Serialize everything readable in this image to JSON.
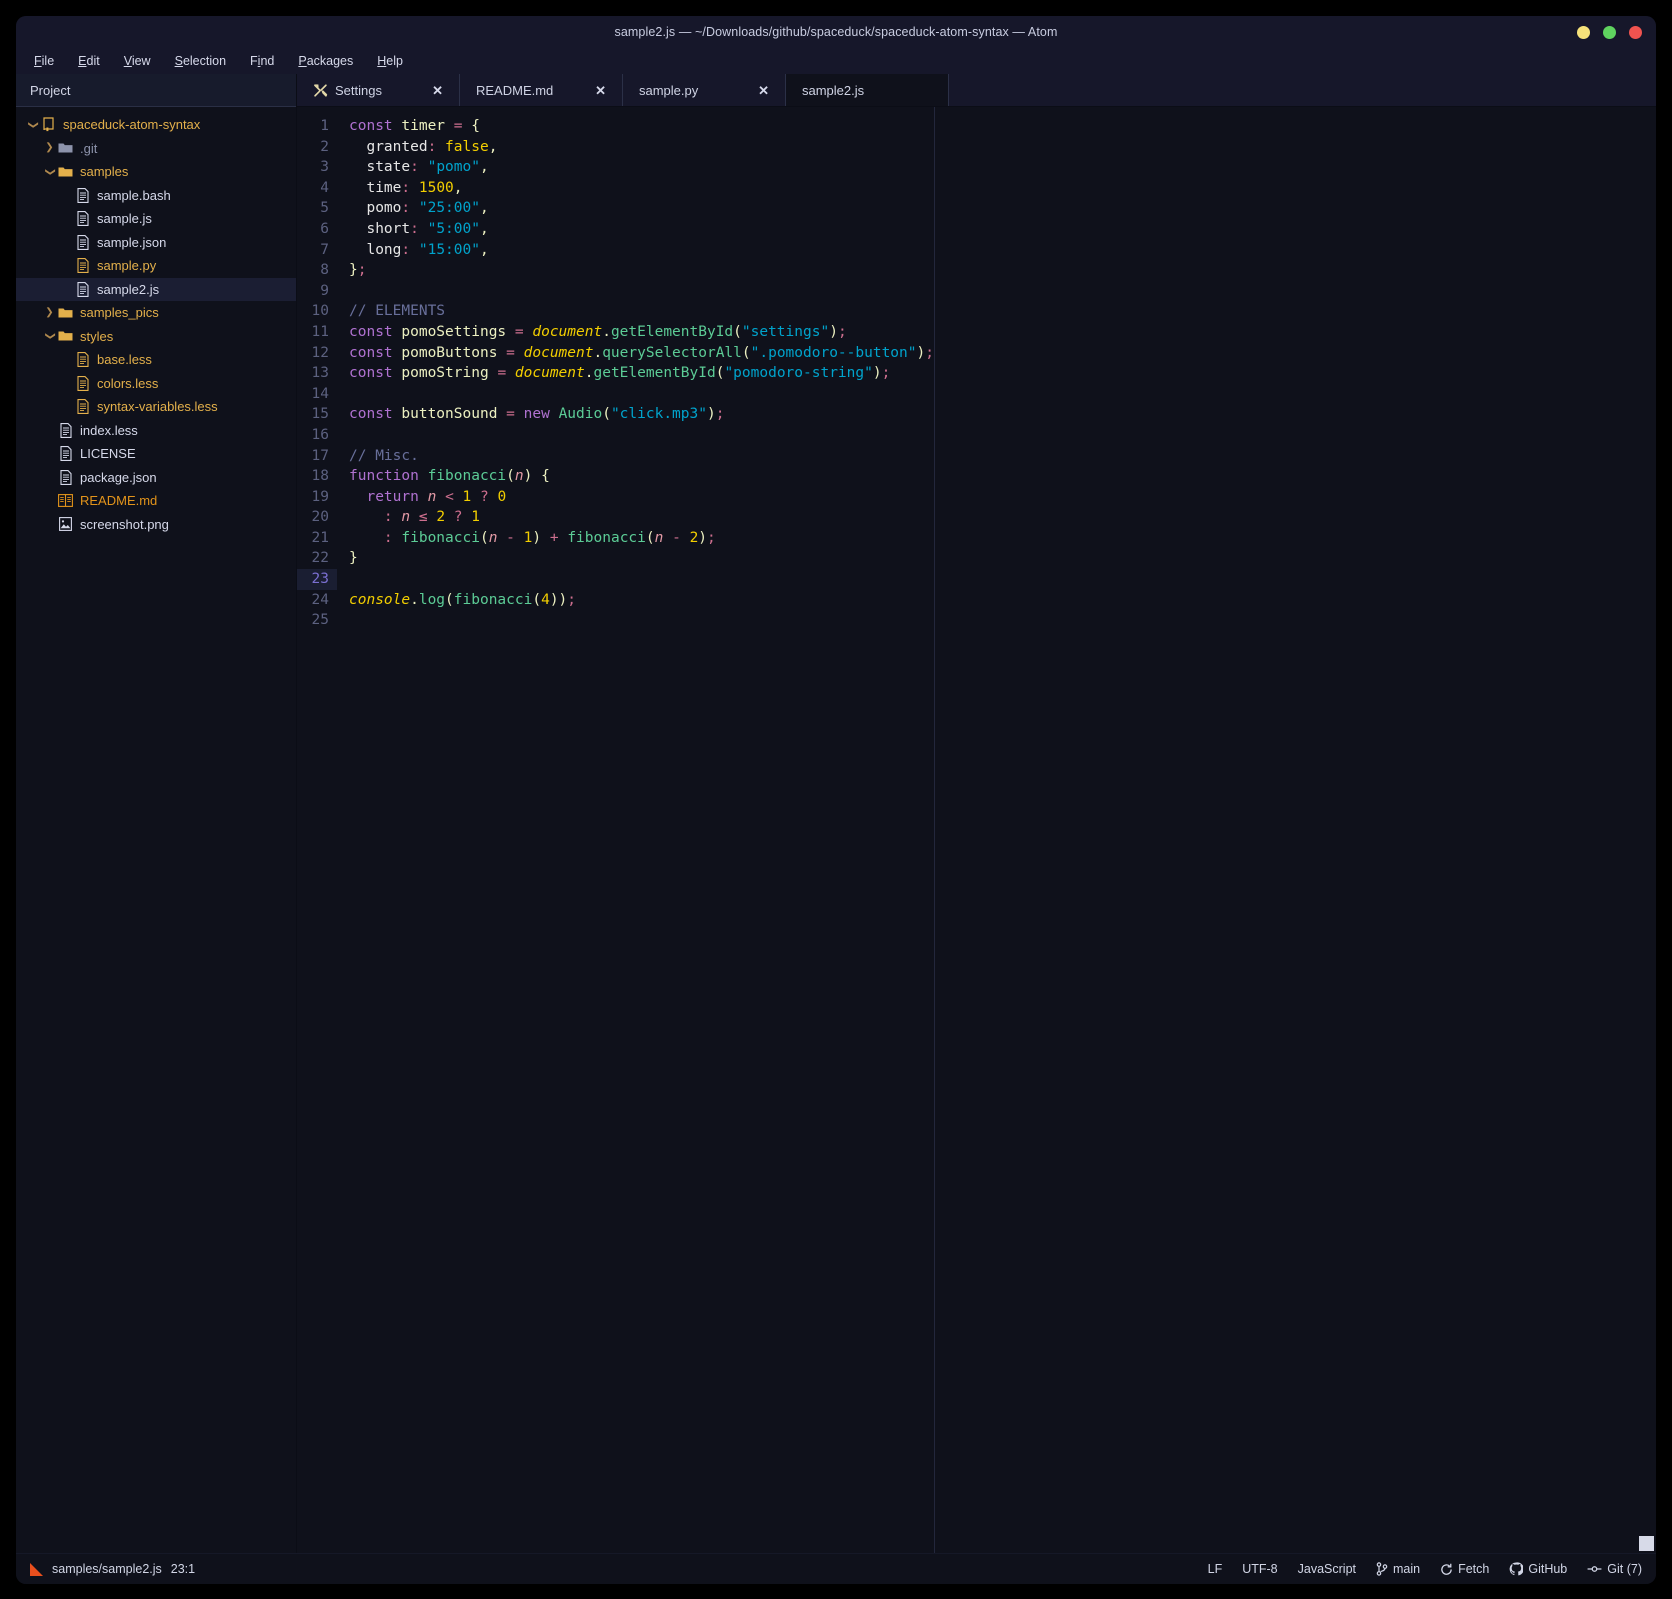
{
  "window": {
    "title": "sample2.js — ~/Downloads/github/spaceduck/spaceduck-atom-syntax — Atom",
    "controls": [
      {
        "name": "minimize",
        "color": "#f6e27a"
      },
      {
        "name": "maximize",
        "color": "#5fd35f"
      },
      {
        "name": "close",
        "color": "#f0534f"
      }
    ]
  },
  "menu": {
    "items": [
      {
        "label": "File",
        "mnemonic": "F"
      },
      {
        "label": "Edit",
        "mnemonic": "E"
      },
      {
        "label": "View",
        "mnemonic": "V"
      },
      {
        "label": "Selection",
        "mnemonic": "S"
      },
      {
        "label": "Find",
        "mnemonic": "i"
      },
      {
        "label": "Packages",
        "mnemonic": "P"
      },
      {
        "label": "Help",
        "mnemonic": "H"
      }
    ]
  },
  "sidebar": {
    "header": "Project",
    "tree": [
      {
        "label": "spaceduck-atom-syntax",
        "icon": "repo-icon",
        "indent": 0,
        "twisty": "down",
        "color": "#e3b04b",
        "selected": false
      },
      {
        "label": ".git",
        "icon": "folder-icon",
        "indent": 1,
        "twisty": "right",
        "color": "#8d93ab",
        "selected": false
      },
      {
        "label": "samples",
        "icon": "folder-icon",
        "indent": 1,
        "twisty": "down",
        "color": "#e3b04b",
        "selected": false
      },
      {
        "label": "sample.bash",
        "icon": "file-icon",
        "indent": 2,
        "twisty": "none",
        "color": "#d6d9ea",
        "selected": false
      },
      {
        "label": "sample.js",
        "icon": "file-icon",
        "indent": 2,
        "twisty": "none",
        "color": "#d6d9ea",
        "selected": false
      },
      {
        "label": "sample.json",
        "icon": "file-icon",
        "indent": 2,
        "twisty": "none",
        "color": "#d6d9ea",
        "selected": false
      },
      {
        "label": "sample.py",
        "icon": "file-icon",
        "indent": 2,
        "twisty": "none",
        "color": "#e3b04b",
        "selected": false
      },
      {
        "label": "sample2.js",
        "icon": "file-icon",
        "indent": 2,
        "twisty": "none",
        "color": "#d6d9ea",
        "selected": true
      },
      {
        "label": "samples_pics",
        "icon": "folder-icon",
        "indent": 1,
        "twisty": "right",
        "color": "#e3b04b",
        "selected": false
      },
      {
        "label": "styles",
        "icon": "folder-icon",
        "indent": 1,
        "twisty": "down",
        "color": "#e3b04b",
        "selected": false
      },
      {
        "label": "base.less",
        "icon": "file-icon",
        "indent": 2,
        "twisty": "none",
        "color": "#e3b04b",
        "selected": false
      },
      {
        "label": "colors.less",
        "icon": "file-icon",
        "indent": 2,
        "twisty": "none",
        "color": "#e3b04b",
        "selected": false
      },
      {
        "label": "syntax-variables.less",
        "icon": "file-icon",
        "indent": 2,
        "twisty": "none",
        "color": "#e3b04b",
        "selected": false
      },
      {
        "label": "index.less",
        "icon": "file-icon",
        "indent": 1,
        "twisty": "none",
        "color": "#d6d9ea",
        "selected": false
      },
      {
        "label": "LICENSE",
        "icon": "file-icon",
        "indent": 1,
        "twisty": "none",
        "color": "#d6d9ea",
        "selected": false
      },
      {
        "label": "package.json",
        "icon": "file-icon",
        "indent": 1,
        "twisty": "none",
        "color": "#d6d9ea",
        "selected": false
      },
      {
        "label": "README.md",
        "icon": "book-icon",
        "indent": 1,
        "twisty": "none",
        "color": "#e3941b",
        "selected": false
      },
      {
        "label": "screenshot.png",
        "icon": "image-icon",
        "indent": 1,
        "twisty": "none",
        "color": "#d6d9ea",
        "selected": false
      }
    ]
  },
  "tabs": [
    {
      "label": "Settings",
      "icon": "tools-icon",
      "active": false,
      "closable": true
    },
    {
      "label": "README.md",
      "icon": "none",
      "active": false,
      "closable": true
    },
    {
      "label": "sample.py",
      "icon": "none",
      "active": false,
      "closable": true
    },
    {
      "label": "sample2.js",
      "icon": "none",
      "active": true,
      "closable": true
    }
  ],
  "editor": {
    "cursor_line": 23,
    "line_count": 25,
    "lines": [
      "const timer = {",
      "  granted: false,",
      "  state: \"pomo\",",
      "  time: 1500,",
      "  pomo: \"25:00\",",
      "  short: \"5:00\",",
      "  long: \"15:00\",",
      "};",
      "",
      "// ELEMENTS",
      "const pomoSettings = document.getElementById(\"settings\");",
      "const pomoButtons = document.querySelectorAll(\".pomodoro--button\");",
      "const pomoString = document.getElementById(\"pomodoro-string\");",
      "",
      "const buttonSound = new Audio(\"click.mp3\");",
      "",
      "// Misc.",
      "function fibonacci(n) {",
      "  return n < 1 ? 0",
      "    : n ≤ 2 ? 1",
      "    : fibonacci(n - 1) + fibonacci(n - 2);",
      "}",
      "",
      "console.log(fibonacci(4));",
      ""
    ]
  },
  "status": {
    "left": {
      "icon": "atom-file-icon",
      "path": "samples/sample2.js",
      "position": "23:1"
    },
    "right": [
      {
        "label": "LF",
        "icon": "none"
      },
      {
        "label": "UTF-8",
        "icon": "none"
      },
      {
        "label": "JavaScript",
        "icon": "none"
      },
      {
        "label": "main",
        "icon": "git-branch-icon"
      },
      {
        "label": "Fetch",
        "icon": "sync-icon"
      },
      {
        "label": "GitHub",
        "icon": "github-icon"
      },
      {
        "label": "Git (7)",
        "icon": "git-commit-icon"
      }
    ]
  },
  "colors": {
    "background": "#0f111b",
    "chrome": "#16172a",
    "accent": "#e3b04b",
    "selection": "#1b1e33"
  }
}
